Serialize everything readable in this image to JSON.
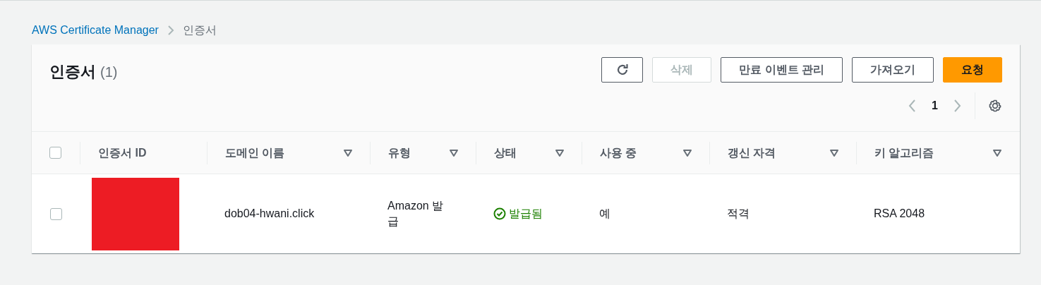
{
  "breadcrumb": [
    {
      "label": "AWS Certificate Manager",
      "kind": "link"
    },
    {
      "label": "인증서",
      "kind": "current"
    }
  ],
  "header": {
    "title": "인증서",
    "count": "(1)"
  },
  "buttons": [
    {
      "kind": "icon",
      "disabled": false,
      "primary": false
    },
    {
      "label": "삭제",
      "kind": "text",
      "disabled": true,
      "primary": false
    },
    {
      "label": "만료 이벤트 관리",
      "kind": "text",
      "disabled": false,
      "primary": false
    },
    {
      "label": "가져오기",
      "kind": "text",
      "disabled": false,
      "primary": false
    },
    {
      "label": "요청",
      "kind": "text",
      "disabled": false,
      "primary": true
    }
  ],
  "pagination": {
    "page": "1"
  },
  "table": {
    "select_all_checked": false,
    "columns": [
      {
        "label": "인증서 ID",
        "sortable": false
      },
      {
        "label": "도메인 이름",
        "sortable": true
      },
      {
        "label": "유형",
        "sortable": true
      },
      {
        "label": "상태",
        "sortable": true
      },
      {
        "label": "사용 중",
        "sortable": true
      },
      {
        "label": "갱신 자격",
        "sortable": true
      },
      {
        "label": "키 알고리즘",
        "sortable": true
      }
    ],
    "rows": [
      {
        "checked": false,
        "id_redacted": true,
        "domain": "dob04-hwani.click",
        "type": "Amazon 발급",
        "status": "발급됨",
        "status_ok": true,
        "in_use": "예",
        "renewal": "적격",
        "key_algorithm": "RSA 2048"
      }
    ]
  }
}
